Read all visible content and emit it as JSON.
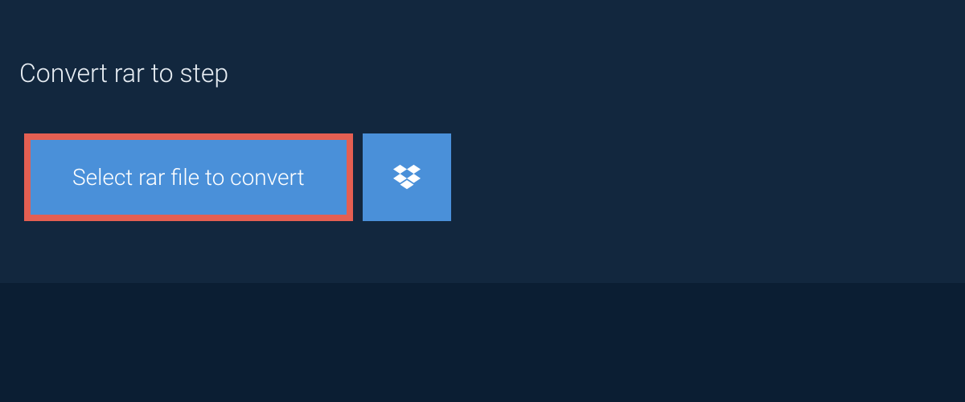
{
  "header": {
    "title": "Convert rar to step"
  },
  "actions": {
    "select_file_label": "Select rar file to convert"
  },
  "colors": {
    "page_bg": "#0b1e33",
    "panel_bg": "#12273e",
    "button_bg": "#4a90d9",
    "highlight_border": "#e45f52",
    "text_light": "#ffffff"
  }
}
